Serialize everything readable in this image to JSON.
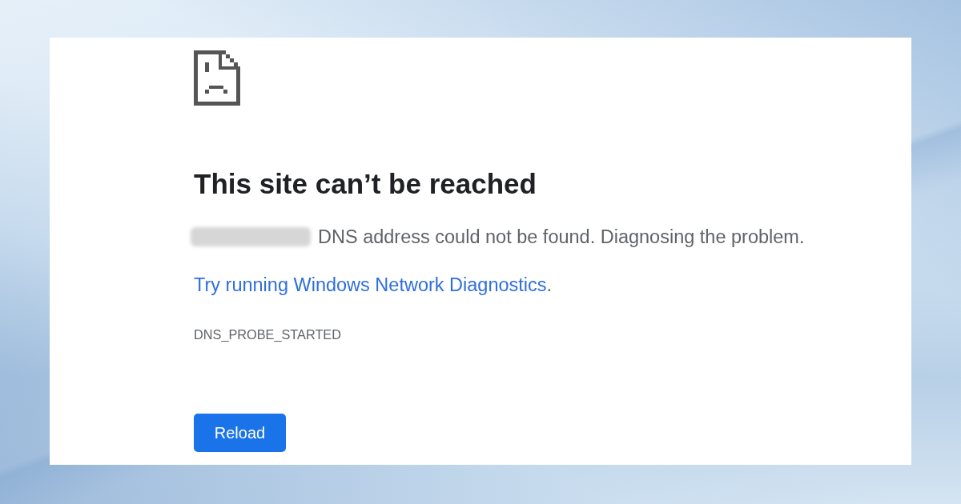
{
  "error_page": {
    "heading": "This site can’t be reached",
    "message": "DNS address could not be found. Diagnosing the problem.",
    "suggestion": {
      "link": "Try running Windows Network Diagnostics",
      "after_link": "."
    },
    "error_code": "DNS_PROBE_STARTED",
    "reload_button": "Reload"
  }
}
